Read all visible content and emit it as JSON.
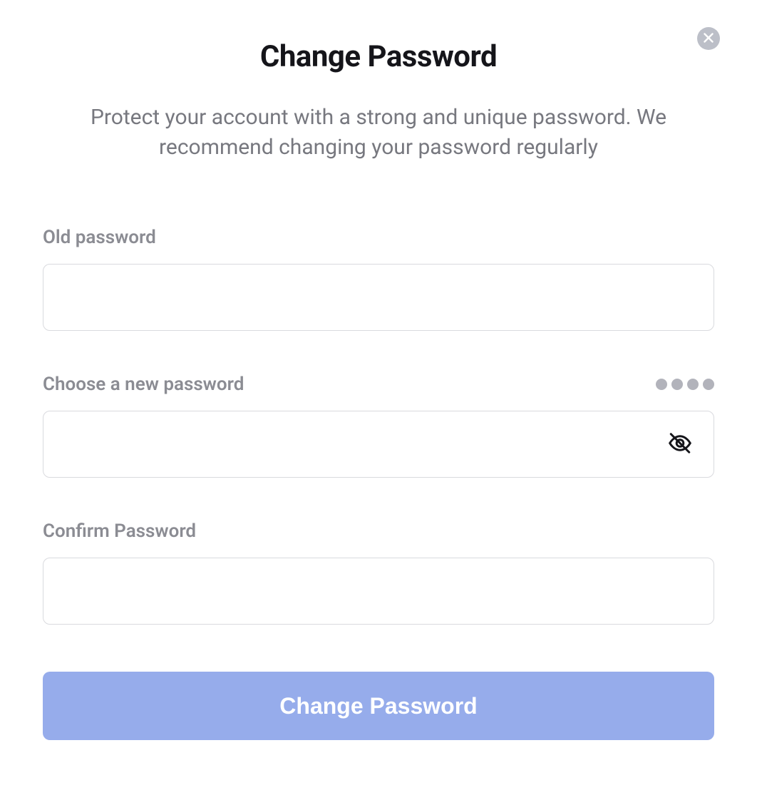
{
  "header": {
    "title": "Change Password",
    "subtitle": "Protect your account with a strong and unique password. We recommend changing your password regularly"
  },
  "fields": {
    "old_password": {
      "label": "Old password",
      "value": ""
    },
    "new_password": {
      "label": "Choose a new password",
      "value": "",
      "strength_levels": 4
    },
    "confirm_password": {
      "label": "Confirm Password",
      "value": ""
    }
  },
  "actions": {
    "submit_label": "Change Password"
  },
  "colors": {
    "primary_button": "#96aceb",
    "text_muted": "#8b8c93",
    "border": "#d9dade"
  }
}
